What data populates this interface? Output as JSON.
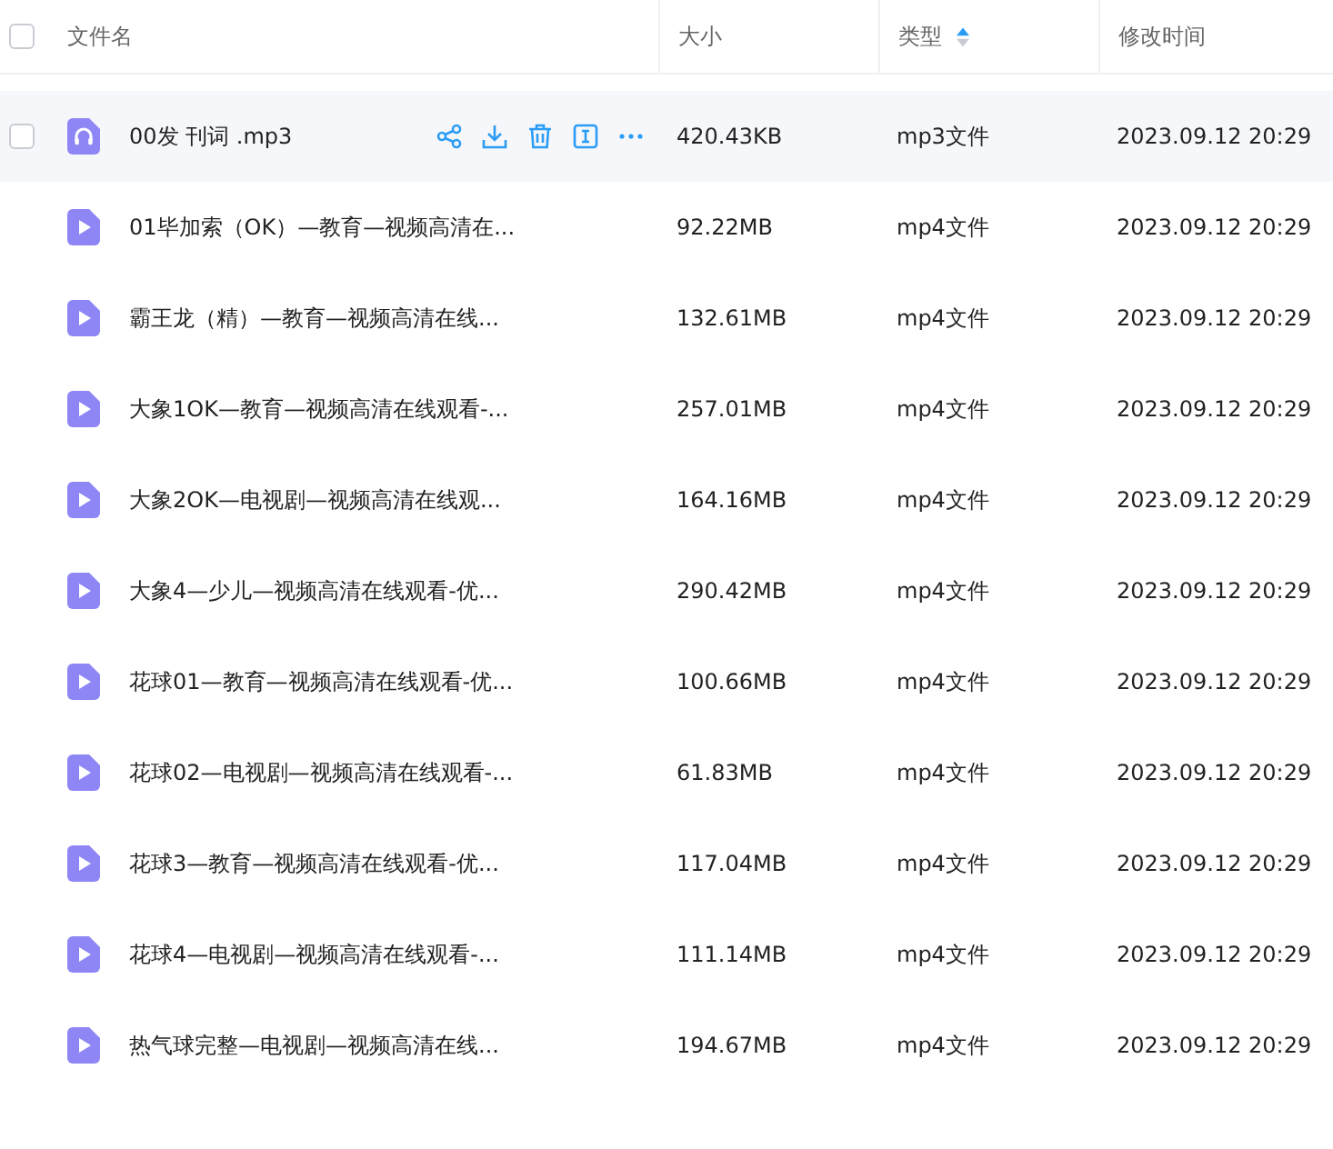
{
  "header": {
    "checked": false,
    "columns": [
      {
        "label": "文件名"
      },
      {
        "label": "大小"
      },
      {
        "label": "类型",
        "sorted": true,
        "ascending": true
      },
      {
        "label": "修改时间"
      }
    ]
  },
  "rows": [
    {
      "kind": "audio",
      "name": "00发 刊词 .mp3",
      "size": "420.43KB",
      "type": "mp3文件",
      "modified": "2023.09.12 20:29",
      "hovered": true,
      "checked": false
    },
    {
      "kind": "video",
      "name": "01毕加索（OK）—教育—视频高清在...",
      "size": "92.22MB",
      "type": "mp4文件",
      "modified": "2023.09.12 20:29",
      "hovered": false,
      "checked": false
    },
    {
      "kind": "video",
      "name": "霸王龙（精）—教育—视频高清在线...",
      "size": "132.61MB",
      "type": "mp4文件",
      "modified": "2023.09.12 20:29",
      "hovered": false,
      "checked": false
    },
    {
      "kind": "video",
      "name": "大象1OK—教育—视频高清在线观看-...",
      "size": "257.01MB",
      "type": "mp4文件",
      "modified": "2023.09.12 20:29",
      "hovered": false,
      "checked": false
    },
    {
      "kind": "video",
      "name": "大象2OK—电视剧—视频高清在线观...",
      "size": "164.16MB",
      "type": "mp4文件",
      "modified": "2023.09.12 20:29",
      "hovered": false,
      "checked": false
    },
    {
      "kind": "video",
      "name": "大象4—少儿—视频高清在线观看-优...",
      "size": "290.42MB",
      "type": "mp4文件",
      "modified": "2023.09.12 20:29",
      "hovered": false,
      "checked": false
    },
    {
      "kind": "video",
      "name": "花球01—教育—视频高清在线观看-优...",
      "size": "100.66MB",
      "type": "mp4文件",
      "modified": "2023.09.12 20:29",
      "hovered": false,
      "checked": false
    },
    {
      "kind": "video",
      "name": "花球02—电视剧—视频高清在线观看-...",
      "size": "61.83MB",
      "type": "mp4文件",
      "modified": "2023.09.12 20:29",
      "hovered": false,
      "checked": false
    },
    {
      "kind": "video",
      "name": "花球3—教育—视频高清在线观看-优...",
      "size": "117.04MB",
      "type": "mp4文件",
      "modified": "2023.09.12 20:29",
      "hovered": false,
      "checked": false
    },
    {
      "kind": "video",
      "name": "花球4—电视剧—视频高清在线观看-...",
      "size": "111.14MB",
      "type": "mp4文件",
      "modified": "2023.09.12 20:29",
      "hovered": false,
      "checked": false
    },
    {
      "kind": "video",
      "name": "热气球完整—电视剧—视频高清在线...",
      "size": "194.67MB",
      "type": "mp4文件",
      "modified": "2023.09.12 20:29",
      "hovered": false,
      "checked": false
    }
  ]
}
